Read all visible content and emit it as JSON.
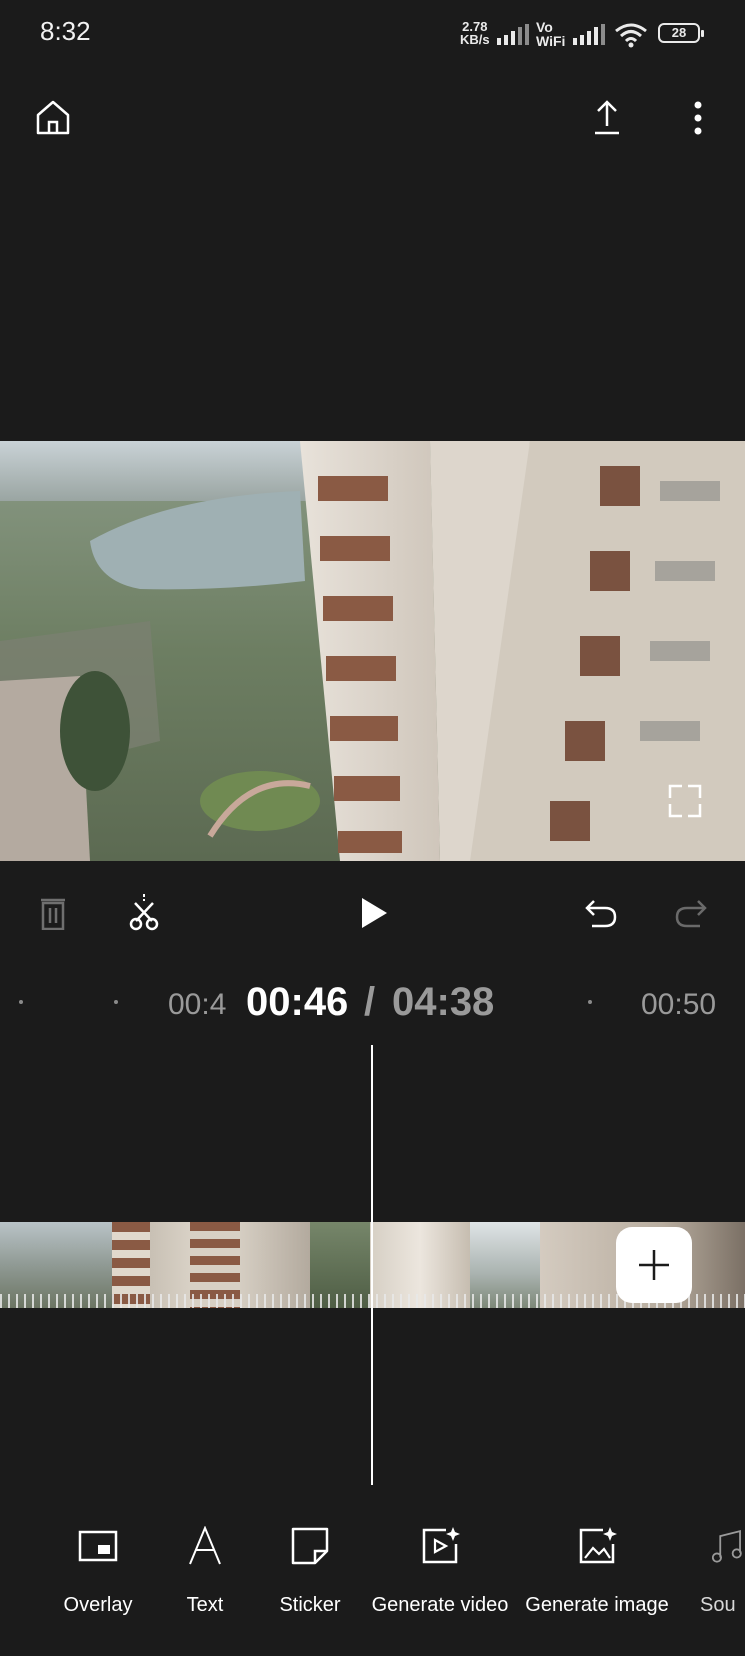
{
  "status_bar": {
    "time": "8:32",
    "network_speed_value": "2.78",
    "network_speed_unit": "KB/s",
    "vo_label": "Vo",
    "wifi_label": "WiFi",
    "battery": "28"
  },
  "header": {
    "home_icon": "home-icon",
    "export_icon": "upload-icon",
    "more_icon": "more-vertical-icon"
  },
  "controls": {
    "delete_icon": "trash-icon",
    "split_icon": "scissors-icon",
    "play_icon": "play-icon",
    "undo_icon": "undo-icon",
    "redo_icon": "redo-icon",
    "fullscreen_icon": "fullscreen-icon"
  },
  "timeline": {
    "current_time": "00:46",
    "separator": "/",
    "total_time": "04:38",
    "tick_left": "00:4",
    "tick_right": "00:50",
    "add_icon": "plus-icon"
  },
  "tools": [
    {
      "label": "Overlay",
      "icon": "overlay-icon"
    },
    {
      "label": "Text",
      "icon": "text-icon"
    },
    {
      "label": "Sticker",
      "icon": "sticker-icon"
    },
    {
      "label": "Generate video",
      "icon": "generate-video-icon"
    },
    {
      "label": "Generate image",
      "icon": "generate-image-icon"
    },
    {
      "label": "Sou",
      "icon": "sound-icon"
    }
  ],
  "colors": {
    "background": "#1b1b1b",
    "accent": "#ffffff",
    "muted": "#9a9a9a"
  }
}
